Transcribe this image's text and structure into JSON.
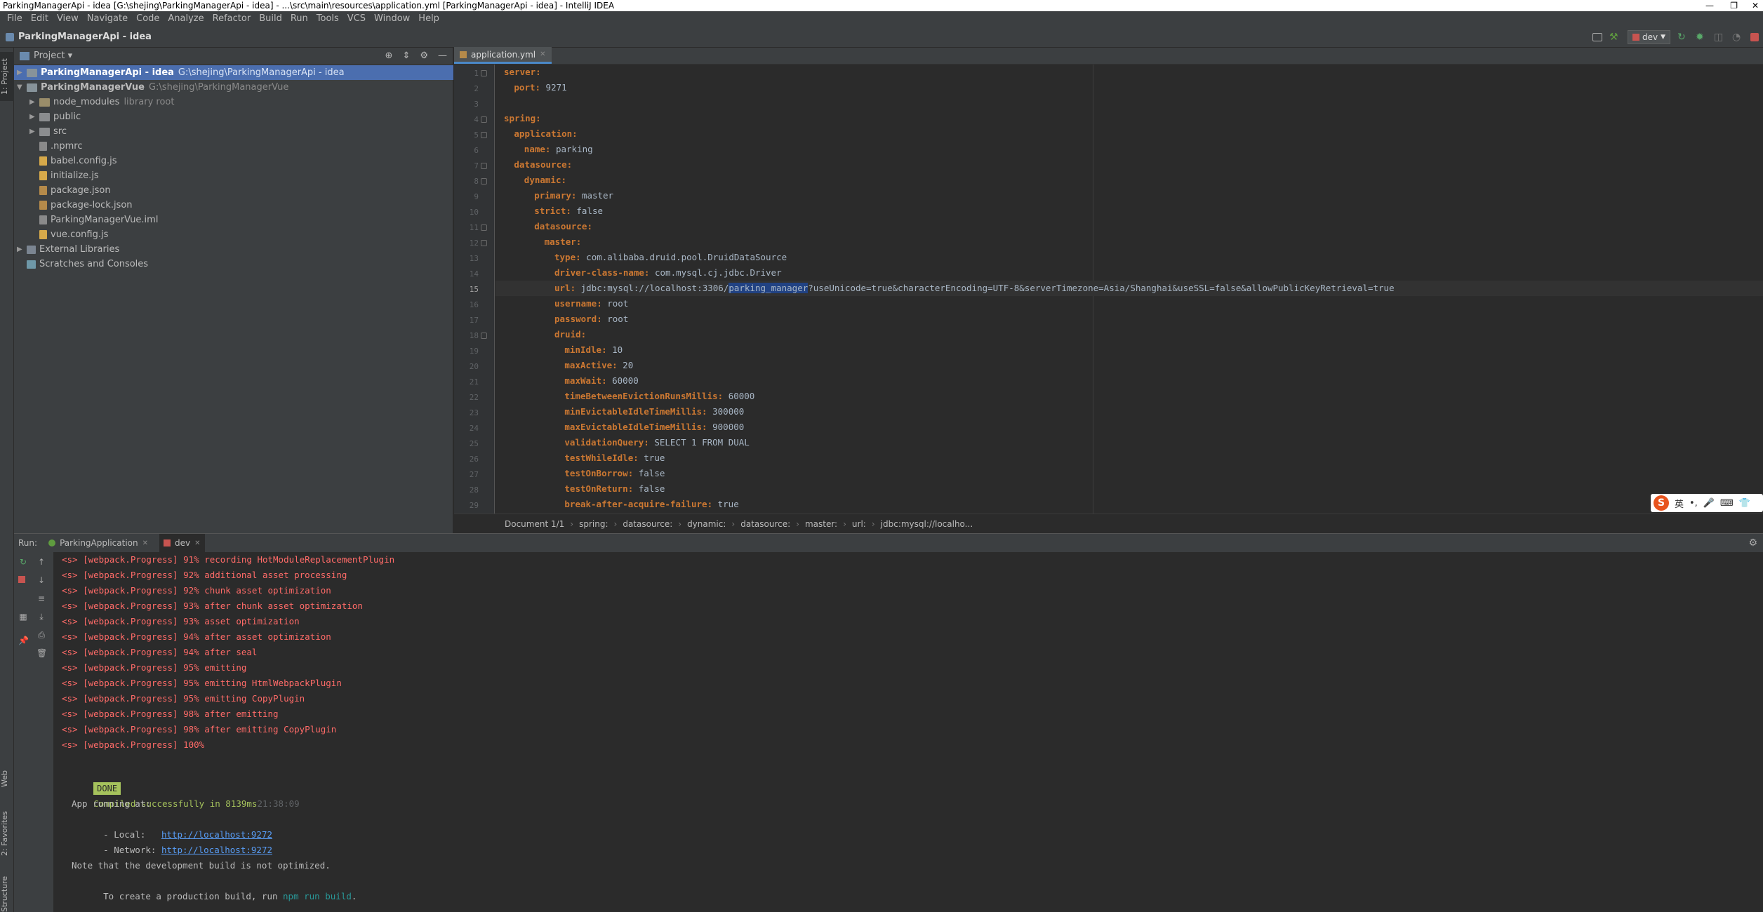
{
  "window": {
    "title": "ParkingManagerApi - idea [G:\\shejing\\ParkingManagerApi - idea] - ...\\src\\main\\resources\\application.yml [ParkingManagerApi - idea] - IntelliJ IDEA"
  },
  "menu": [
    "File",
    "Edit",
    "View",
    "Navigate",
    "Code",
    "Analyze",
    "Refactor",
    "Build",
    "Run",
    "Tools",
    "VCS",
    "Window",
    "Help"
  ],
  "navbar": {
    "breadcrumb": "ParkingManagerApi - idea",
    "run_config": "dev"
  },
  "left_strip": {
    "project_tab": "1: Project",
    "web_tab": "Web",
    "favorites_tab": "2: Favorites",
    "structure_tab": "Structure"
  },
  "project": {
    "header": "Project",
    "tree": [
      {
        "label": "ParkingManagerApi - idea",
        "path": "G:\\shejing\\ParkingManagerApi - idea"
      },
      {
        "label": "ParkingManagerVue",
        "path": "G:\\shejing\\ParkingManagerVue"
      },
      {
        "label": "node_modules",
        "path": "library root"
      },
      {
        "label": "public"
      },
      {
        "label": "src"
      },
      {
        "label": ".npmrc"
      },
      {
        "label": "babel.config.js"
      },
      {
        "label": "initialize.js"
      },
      {
        "label": "package.json"
      },
      {
        "label": "package-lock.json"
      },
      {
        "label": "ParkingManagerVue.iml"
      },
      {
        "label": "vue.config.js"
      },
      {
        "label": "External Libraries"
      },
      {
        "label": "Scratches and Consoles"
      }
    ]
  },
  "editor": {
    "tab": "application.yml",
    "line_numbers": [
      "1",
      "2",
      "3",
      "4",
      "5",
      "6",
      "7",
      "8",
      "9",
      "10",
      "11",
      "12",
      "13",
      "14",
      "15",
      "16",
      "17",
      "18",
      "19",
      "20",
      "21",
      "22",
      "23",
      "24",
      "25",
      "26",
      "27",
      "28",
      "29"
    ],
    "lines": [
      {
        "key": "server:",
        "val": ""
      },
      {
        "key": "port:",
        "val": " 9271"
      },
      {
        "key": "",
        "val": ""
      },
      {
        "key": "spring:",
        "val": ""
      },
      {
        "key": "application:",
        "val": ""
      },
      {
        "key": "name:",
        "val": " parking"
      },
      {
        "key": "datasource:",
        "val": ""
      },
      {
        "key": "dynamic:",
        "val": ""
      },
      {
        "key": "primary:",
        "val": " master"
      },
      {
        "key": "strict:",
        "val": " false"
      },
      {
        "key": "datasource:",
        "val": ""
      },
      {
        "key": "master:",
        "val": ""
      },
      {
        "key": "type:",
        "val": " com.alibaba.druid.pool.DruidDataSource"
      },
      {
        "key": "driver-class-name:",
        "val": " com.mysql.cj.jdbc.Driver"
      },
      {
        "key": "url:",
        "val": " jdbc:mysql://localhost:3306/",
        "hl": "parking_manager",
        "rest": "?useUnicode=true&characterEncoding=UTF-8&serverTimezone=Asia/Shanghai&useSSL=false&allowPublicKeyRetrieval=true"
      },
      {
        "key": "username:",
        "val": " root"
      },
      {
        "key": "password:",
        "val": " root"
      },
      {
        "key": "druid:",
        "val": ""
      },
      {
        "key": "minIdle:",
        "val": " 10"
      },
      {
        "key": "maxActive:",
        "val": " 20"
      },
      {
        "key": "maxWait:",
        "val": " 60000"
      },
      {
        "key": "timeBetweenEvictionRunsMillis:",
        "val": " 60000"
      },
      {
        "key": "minEvictableIdleTimeMillis:",
        "val": " 300000"
      },
      {
        "key": "maxEvictableIdleTimeMillis:",
        "val": " 900000"
      },
      {
        "key": "validationQuery:",
        "val": " SELECT 1 FROM DUAL"
      },
      {
        "key": "testWhileIdle:",
        "val": " true"
      },
      {
        "key": "testOnBorrow:",
        "val": " false"
      },
      {
        "key": "testOnReturn:",
        "val": " false"
      },
      {
        "key": "break-after-acquire-failure:",
        "val": " true"
      }
    ],
    "breadcrumbs": [
      "Document 1/1",
      "spring:",
      "datasource:",
      "dynamic:",
      "datasource:",
      "master:",
      "url:",
      "jdbc:mysql://localho..."
    ]
  },
  "ime": {
    "logo": "S",
    "lang": "英"
  },
  "run": {
    "label": "Run:",
    "tabs": [
      "ParkingApplication",
      "dev"
    ],
    "console": [
      "<s> [webpack.Progress] 91% recording HotModuleReplacementPlugin",
      "<s> [webpack.Progress] 92% additional asset processing",
      "<s> [webpack.Progress] 92% chunk asset optimization",
      "<s> [webpack.Progress] 93% after chunk asset optimization",
      "<s> [webpack.Progress] 93% asset optimization",
      "<s> [webpack.Progress] 94% after asset optimization",
      "<s> [webpack.Progress] 94% after seal",
      "<s> [webpack.Progress] 95% emitting",
      "<s> [webpack.Progress] 95% emitting HtmlWebpackPlugin",
      "<s> [webpack.Progress] 95% emitting CopyPlugin",
      "<s> [webpack.Progress] 98% after emitting",
      "<s> [webpack.Progress] 98% after emitting CopyPlugin",
      "<s> [webpack.Progress] 100%"
    ],
    "done_badge": "DONE",
    "compiled_msg": "Compiled successfully in 8139ms",
    "compiled_time": "21:38:09",
    "app_running": "App running at:",
    "local_label": "- Local:   ",
    "local_url": "http://localhost:9272",
    "network_label": "- Network: ",
    "network_url": "http://localhost:9272",
    "note": "Note that the development build is not optimized.",
    "prod_prefix": "To create a production build, run ",
    "prod_cmd": "npm run build",
    "prod_suffix": "."
  },
  "colors": {
    "accent": "#4b6eaf",
    "yaml_key": "#cc7832",
    "console_error": "#ff6b68",
    "done_green": "#a5c25c",
    "link": "#589df6"
  }
}
